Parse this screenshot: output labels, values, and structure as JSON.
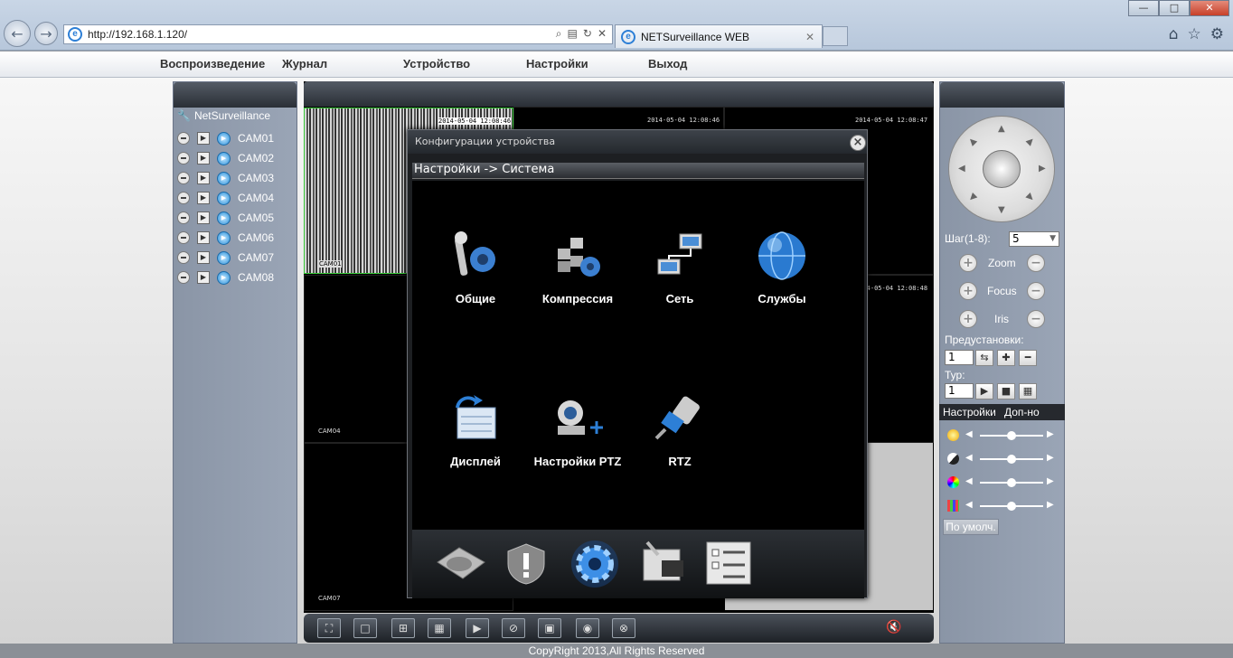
{
  "browser": {
    "address": "http://192.168.1.120/",
    "tab_title": "NETSurveillance WEB",
    "minimize": "—",
    "maximize": "□",
    "close": "✕"
  },
  "app_menu": [
    "Воспроизведение",
    "Журнал",
    "Устройство",
    "Настройки",
    "Выход"
  ],
  "device_tree": {
    "root": "NetSurveillance",
    "cameras": [
      "CAM01",
      "CAM02",
      "CAM03",
      "CAM04",
      "CAM05",
      "CAM06",
      "CAM07",
      "CAM08"
    ]
  },
  "video_grid": {
    "timestamps": [
      "2014-05-04 12:08:46",
      "2014-05-04 12:08:46",
      "2014-05-04 12:08:47",
      "2014-05-04 12:08:48"
    ],
    "cell_labels": [
      "CAM01",
      "CAM04",
      "CAM07"
    ]
  },
  "modal": {
    "title": "Конфигурации устройства",
    "breadcrumb": "Настройки -> Система",
    "tiles": [
      "Общие",
      "Компрессия",
      "Сеть",
      "Службы",
      "Дисплей",
      "Настройки PTZ",
      "RTZ"
    ]
  },
  "ptz": {
    "step_label": "Шаг(1-8):",
    "step_value": "5",
    "zoom_label": "Zoom",
    "focus_label": "Focus",
    "iris_label": "Iris",
    "presets_label": "Предустановки:",
    "preset_value": "1",
    "tour_label": "Тур:",
    "tour_value": "1"
  },
  "image_tabs": [
    "Настройки",
    "Доп-но"
  ],
  "default_button": "По умолч.",
  "footer": "CopyRight 2013,All Rights Reserved",
  "colors": {
    "selected_cell_border": "#37c837",
    "header_dark": "#2a2f36",
    "panel": "#9aa5b6"
  }
}
